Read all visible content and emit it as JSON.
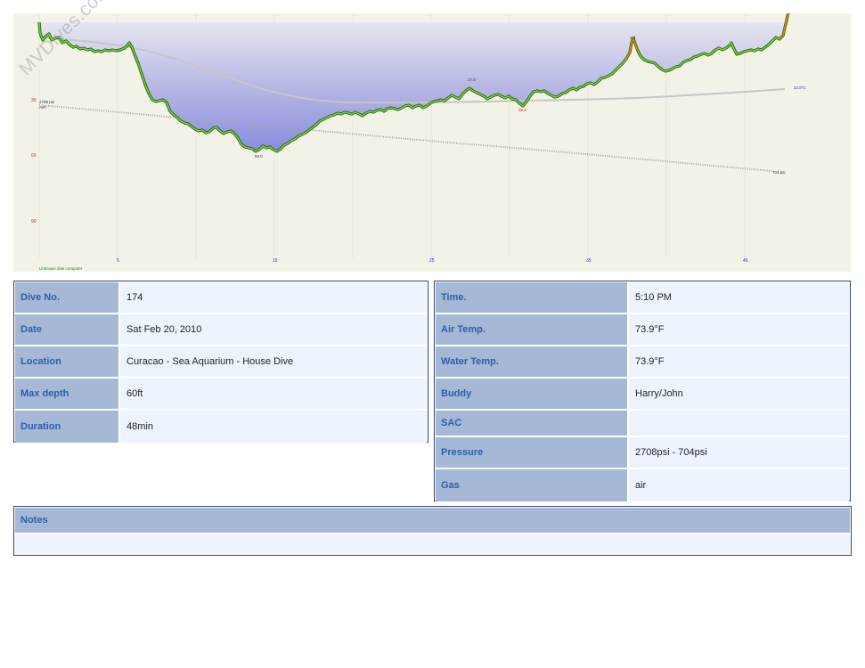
{
  "profile": {
    "watermark": "MVDives.com",
    "computer_label": "Unknown dive computer",
    "gas_label": "AIR",
    "pressure_start": "2708 psi",
    "pressure_end": "704 psi",
    "temp_label": "22.8°C",
    "depth_axis_labels": [
      "30",
      "60",
      "90"
    ],
    "time_axis_labels": [
      "5",
      "15",
      "25",
      "35",
      "45"
    ],
    "max_depth_marker": "59.0",
    "point_markers": [
      "36.0",
      "17.0",
      "3.0"
    ],
    "colors": {
      "background": "#f3f2e7",
      "profile_fill_top": "#e4e4ee",
      "profile_fill_bottom": "#8c8ede",
      "profile_line_light": "#7fcd2e",
      "profile_line_dark": "#105a14",
      "ascent_warning": "#d08010",
      "pressure_line": "#9a9a9a",
      "temp_line": "#c6c6c6",
      "depth_label": "#cc2020",
      "time_label": "#2030cc"
    }
  },
  "dive_info": {
    "left": [
      {
        "label": "Dive No.",
        "value": "174"
      },
      {
        "label": "Date",
        "value": "Sat Feb 20, 2010"
      },
      {
        "label": "Location",
        "value": "Curacao - Sea Aquarium - House Dive"
      },
      {
        "label": "Max depth",
        "value": "60ft"
      },
      {
        "label": "Duration",
        "value": "48min"
      }
    ],
    "right": [
      {
        "label": "Time.",
        "value": "5:10 PM"
      },
      {
        "label": "Air Temp.",
        "value": "73.9°F"
      },
      {
        "label": "Water Temp.",
        "value": "73.9°F"
      },
      {
        "label": "Buddy",
        "value": "Harry/John"
      },
      {
        "label": "SAC",
        "value": ""
      },
      {
        "label": "Pressure",
        "value": "2708psi - 704psi"
      },
      {
        "label": "Gas",
        "value": "air"
      }
    ]
  },
  "notes": {
    "label": "Notes",
    "text": ""
  }
}
